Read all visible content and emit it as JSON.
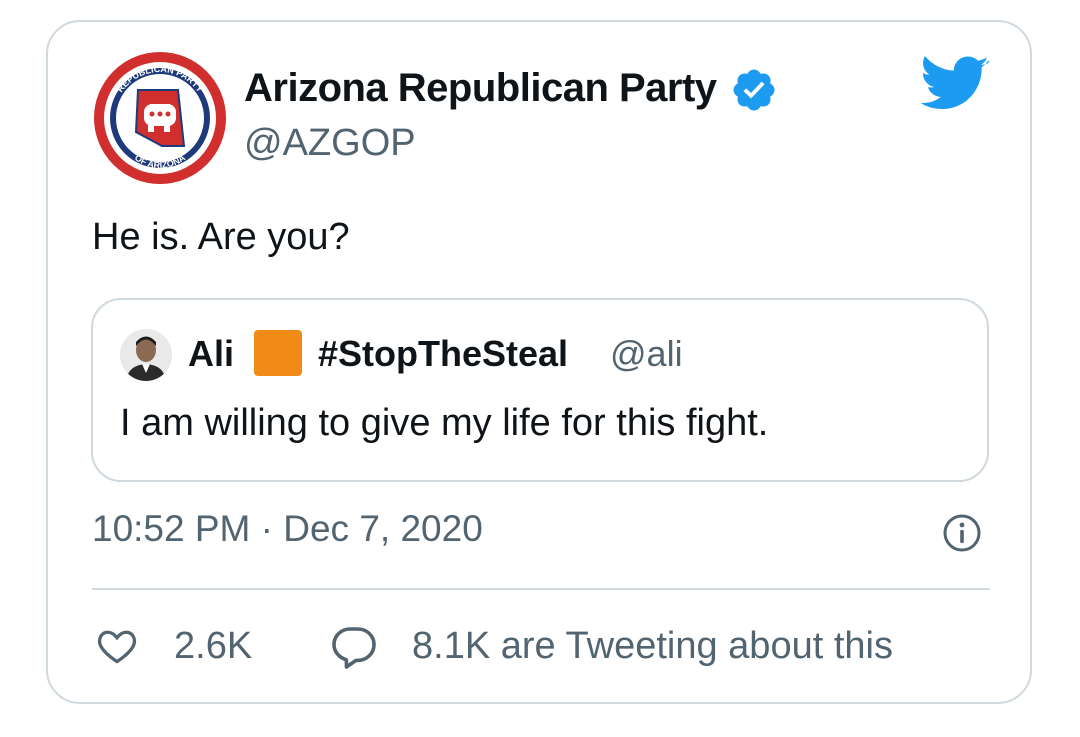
{
  "author": {
    "display_name": "Arizona Republican Party",
    "handle": "@AZGOP",
    "verified": true,
    "avatar_icon": "azgop-seal-logo",
    "avatar_text_top": "REPUBLICAN PARTY",
    "avatar_text_bottom": "OF ARIZONA"
  },
  "platform_icon": "twitter-bird-icon",
  "tweet": {
    "text": "He is. Are you?",
    "timestamp": "10:52 PM · Dec 7, 2020"
  },
  "quoted_tweet": {
    "name": "Ali",
    "emoji_icon": "orange-square",
    "hashtag": "#StopTheSteal",
    "handle": "@ali",
    "text": "I am willing to give my life for this fight."
  },
  "engagement": {
    "likes": "2.6K",
    "tweeting": "8.1K are Tweeting about this"
  },
  "colors": {
    "verified_blue": "#1d9bf0",
    "twitter_blue": "#1d9bf0",
    "secondary_text": "#536471",
    "border": "#cfd9de",
    "logo_red": "#d12e2e",
    "logo_navy": "#1f3a7a",
    "emoji_orange": "#f28b16"
  }
}
